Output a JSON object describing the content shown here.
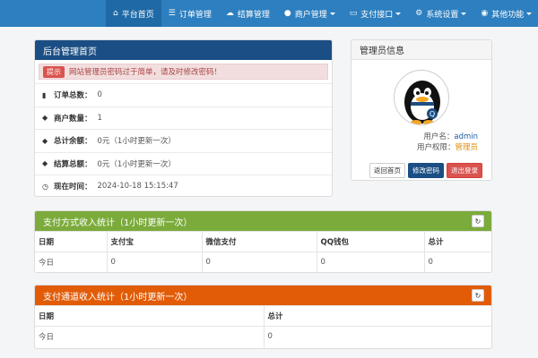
{
  "nav": {
    "items": [
      {
        "label": "平台首页",
        "icon": "home-icon",
        "active": true,
        "dropdown": false
      },
      {
        "label": "订单管理",
        "icon": "list-icon",
        "active": false,
        "dropdown": false
      },
      {
        "label": "结算管理",
        "icon": "cloud-icon",
        "active": false,
        "dropdown": false
      },
      {
        "label": "商户管理",
        "icon": "user-icon",
        "active": false,
        "dropdown": true
      },
      {
        "label": "支付接口",
        "icon": "credit-card-icon",
        "active": false,
        "dropdown": true
      },
      {
        "label": "系统设置",
        "icon": "gear-icon",
        "active": false,
        "dropdown": true
      },
      {
        "label": "其他功能",
        "icon": "globe-icon",
        "active": false,
        "dropdown": true
      }
    ]
  },
  "main": {
    "title": "后台管理首页",
    "alert_badge": "提示",
    "alert_text": "网站管理员密码过于简单，请及时修改密码！",
    "rows": [
      {
        "icon": "bar-chart-icon",
        "label": "订单总数：",
        "value": "0"
      },
      {
        "icon": "drop-icon",
        "label": "商户数量：",
        "value": "1"
      },
      {
        "icon": "drop-icon",
        "label": "总计余额：",
        "value": "0元（1小时更新一次）"
      },
      {
        "icon": "drop-icon",
        "label": "结算总额：",
        "value": "0元（1小时更新一次）"
      },
      {
        "icon": "clock-icon",
        "label": "现在时间：",
        "value": "2024-10-18 15:15:47"
      }
    ]
  },
  "admin": {
    "title": "管理员信息",
    "username_label": "用户名：",
    "username": "admin",
    "role_label": "用户权限：",
    "role": "管理员",
    "btn_home": "返回首页",
    "btn_password": "修改密码",
    "btn_logout": "退出登录"
  },
  "pay_type": {
    "title": "支付方式收入统计（1小时更新一次）",
    "headers": [
      "日期",
      "支付宝",
      "微信支付",
      "QQ钱包",
      "总计"
    ],
    "rows": [
      [
        "今日",
        "0",
        "0",
        "0",
        "0"
      ]
    ]
  },
  "channel": {
    "title": "支付通道收入统计（1小时更新一次）",
    "headers": [
      "日期",
      "总计"
    ],
    "rows": [
      [
        "今日",
        "0"
      ]
    ]
  },
  "colors": {
    "navbar": "#2d7fbf",
    "blue_heading": "#1b4e84",
    "green_heading": "#7bab3b",
    "orange_heading": "#e25c08"
  }
}
